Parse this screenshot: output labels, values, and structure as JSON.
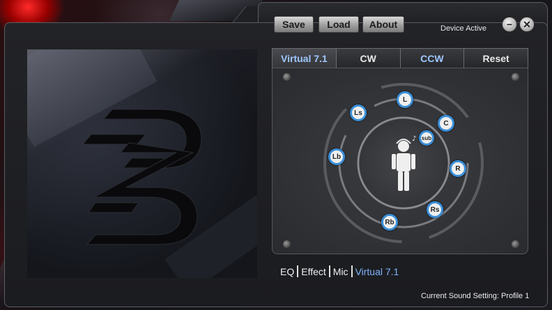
{
  "toolbar": {
    "save_label": "Save",
    "load_label": "Load",
    "about_label": "About",
    "device_status": "Device Active",
    "minimize_icon": "minimize-icon",
    "close_icon": "close-icon"
  },
  "surround": {
    "tabs": [
      {
        "label": "Virtual 7.1"
      },
      {
        "label": "CW"
      },
      {
        "label": "CCW"
      },
      {
        "label": "Reset"
      }
    ],
    "speakers": {
      "L": "L",
      "C": "C",
      "R": "R",
      "Ls": "Ls",
      "Lb": "Lb",
      "Rb": "Rb",
      "Rs": "Rs",
      "sub": "sub"
    }
  },
  "nav": {
    "items": [
      {
        "label": "EQ"
      },
      {
        "label": "Effect"
      },
      {
        "label": "Mic"
      },
      {
        "label": "Virtual 7.1"
      }
    ]
  },
  "footer": {
    "status": "Current Sound Setting: Profile 1"
  },
  "colors": {
    "accent_blue": "#3b8fd8",
    "active_text": "#7fb3ff"
  }
}
